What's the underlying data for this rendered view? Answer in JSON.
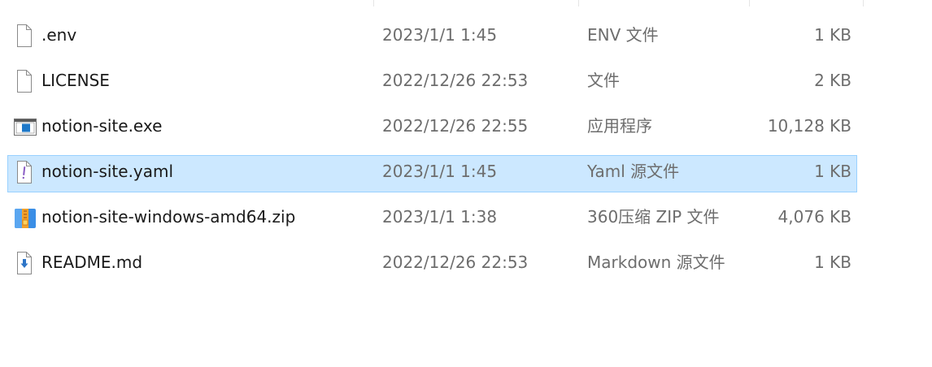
{
  "files": [
    {
      "name": ".env",
      "date": "2023/1/1 1:45",
      "type": "ENV 文件",
      "size": "1 KB",
      "icon": "blank-file-icon",
      "selected": false
    },
    {
      "name": "LICENSE",
      "date": "2022/12/26 22:53",
      "type": "文件",
      "size": "2 KB",
      "icon": "blank-file-icon",
      "selected": false
    },
    {
      "name": "notion-site.exe",
      "date": "2022/12/26 22:55",
      "type": "应用程序",
      "size": "10,128 KB",
      "icon": "exe-file-icon",
      "selected": false
    },
    {
      "name": "notion-site.yaml",
      "date": "2023/1/1 1:45",
      "type": "Yaml 源文件",
      "size": "1 KB",
      "icon": "yaml-file-icon",
      "selected": true
    },
    {
      "name": "notion-site-windows-amd64.zip",
      "date": "2023/1/1 1:38",
      "type": "360压缩 ZIP 文件",
      "size": "4,076 KB",
      "icon": "zip-archive-icon",
      "selected": false
    },
    {
      "name": "README.md",
      "date": "2022/12/26 22:53",
      "type": "Markdown 源文件",
      "size": "1 KB",
      "icon": "markdown-file-icon",
      "selected": false
    }
  ],
  "colors": {
    "selection_fill": "#cce8ff",
    "selection_border": "#99d1ff",
    "secondary_text": "#6d6d6d"
  }
}
